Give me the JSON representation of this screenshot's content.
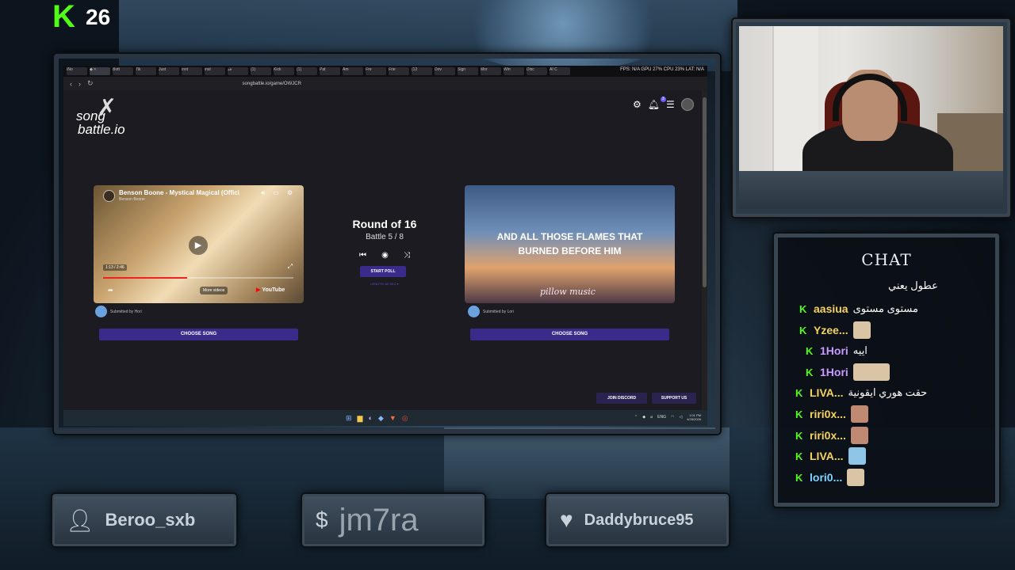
{
  "kick_badge": {
    "letter": "K",
    "count": "26"
  },
  "browser": {
    "tabs": [
      "INo",
      "◆ ×",
      "Bott",
      "Tik",
      "Just",
      "Inst",
      "inst",
      "قد",
      "(1)",
      "Kick",
      "(1)",
      "Pat",
      "Am",
      "Fre",
      "Frie",
      "(12",
      "Dov",
      "Sign",
      "Mor",
      "Win",
      "Disc",
      "AI C"
    ],
    "sys_stats": "FPS: N/A  GPU 27%  CPU 23%  LAT: N/A",
    "url": "songbattle.io/game/OWJCR"
  },
  "app": {
    "logo_line1": "song",
    "logo_line2": "battle.io",
    "notification_count": "3",
    "left_song": {
      "title": "Benson Boone - Mystical Magical (Offici",
      "channel": "Benson Boone",
      "time": "1:13 / 2:46",
      "progress": 0.44,
      "more_videos": "More videos",
      "youtube": "YouTube",
      "submitted_by": "Submitted by Hori",
      "choose": "CHOOSE SONG"
    },
    "right_song": {
      "lyrics_line1": "AND ALL THOSE FLAMES THAT",
      "lyrics_line2": "BURNED BEFORE HIM",
      "watermark": "pillow music",
      "submitted_by": "Submitted by Lori",
      "choose": "CHOOSE SONG"
    },
    "round": "Round of 16",
    "battle": "Battle 5 / 8",
    "start_poll": "START POLL",
    "length": "LENGTH: 60 SEC ▾",
    "join_discord": "JOIN DISCORD",
    "support_us": "SUPPORT US"
  },
  "taskbar": {
    "tray_lang": "ENG",
    "time": "1:01 PM",
    "date": "4/25/2026"
  },
  "chat": {
    "title": "CHAT",
    "messages": [
      {
        "user": "",
        "text": "عطول يعني",
        "color": "#ffffff"
      },
      {
        "user": "aasiua",
        "text": "مستوى مستوى",
        "color": "#f4d35e"
      },
      {
        "user": "Yzee...",
        "text": "",
        "color": "#f4d35e"
      },
      {
        "user": "1Hori",
        "text": "اييه",
        "color": "#c79bff"
      },
      {
        "user": "1Hori",
        "text": "",
        "color": "#c79bff"
      },
      {
        "user": "LIVA...",
        "text": "حقت هوري ايقونية",
        "color": "#f4d35e"
      },
      {
        "user": "riri0x...",
        "text": "",
        "color": "#f4d35e"
      },
      {
        "user": "riri0x...",
        "text": "",
        "color": "#f4d35e"
      },
      {
        "user": "LIVA...",
        "text": "",
        "color": "#f4d35e"
      },
      {
        "user": "lori0...",
        "text": "",
        "color": "#7fd4ff"
      }
    ]
  },
  "panels": {
    "follower": "Beroo_sxb",
    "donation": "jm7ra",
    "sub": "Daddybruce95"
  }
}
